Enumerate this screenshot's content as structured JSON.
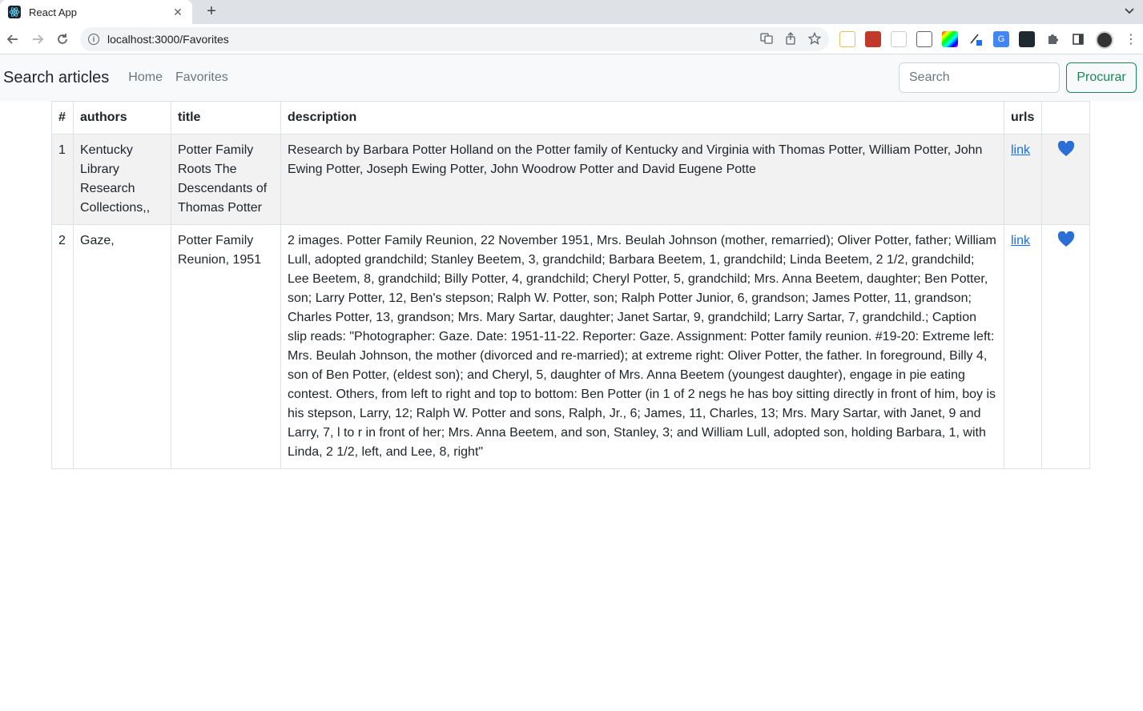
{
  "browser": {
    "tab_title": "React App",
    "url": "localhost:3000/Favorites"
  },
  "navbar": {
    "brand": "Search articles",
    "links": [
      "Home",
      "Favorites"
    ],
    "search_placeholder": "Search",
    "search_button": "Procurar"
  },
  "table": {
    "headers": [
      "#",
      "authors",
      "title",
      "description",
      "urls",
      ""
    ],
    "rows": [
      {
        "num": "1",
        "authors": "Kentucky Library Research Collections,,",
        "title": "Potter Family Roots The Descendants of Thomas Potter",
        "description": "Research by Barbara Potter Holland on the Potter family of Kentucky and Virginia with Thomas Potter, William Potter, John Ewing Potter, Joseph Ewing Potter, John Woodrow Potter and David Eugene Potte",
        "url_label": "link"
      },
      {
        "num": "2",
        "authors": "Gaze,",
        "title": "Potter Family Reunion, 1951",
        "description": "2 images. Potter Family Reunion, 22 November 1951, Mrs. Beulah Johnson (mother, remarried); Oliver Potter, father; William Lull, adopted grandchild; Stanley Beetem, 3, grandchild; Barbara Beetem, 1, grandchild; Linda Beetem, 2 1/2, grandchild; Lee Beetem, 8, grandchild; Billy Potter, 4, grandchild; Cheryl Potter, 5, grandchild; Mrs. Anna Beetem, daughter; Ben Potter, son; Larry Potter, 12, Ben's stepson; Ralph W. Potter, son; Ralph Potter Junior, 6, grandson; James Potter, 11, grandson; Charles Potter, 13, grandson; Mrs. Mary Sartar, daughter; Janet Sartar, 9, grandchild; Larry Sartar, 7, grandchild.; Caption slip reads: \"Photographer: Gaze. Date: 1951-11-22. Reporter: Gaze. Assignment: Potter family reunion. #19-20: Extreme left: Mrs. Beulah Johnson, the mother (divorced and re-married); at extreme right: Oliver Potter, the father. In foreground, Billy 4, son of Ben Potter, (eldest son); and Cheryl, 5, daughter of Mrs. Anna Beetem (youngest daughter), engage in pie eating contest. Others, from left to right and top to bottom: Ben Potter (in 1 of 2 negs he has boy sitting directly in front of him, boy is his stepson, Larry, 12; Ralph W. Potter and sons, Ralph, Jr., 6; James, 11, Charles, 13; Mrs. Mary Sartar, with Janet, 9 and Larry, 7, l to r in front of her; Mrs. Anna Beetem, and son, Stanley, 3; and William Lull, adopted son, holding Barbara, 1, with Linda, 2 1/2, left, and Lee, 8, right\"",
        "url_label": "link"
      }
    ]
  },
  "colors": {
    "heart": "#2b6fd6",
    "link": "#0d6efd",
    "button_outline": "#198754"
  }
}
